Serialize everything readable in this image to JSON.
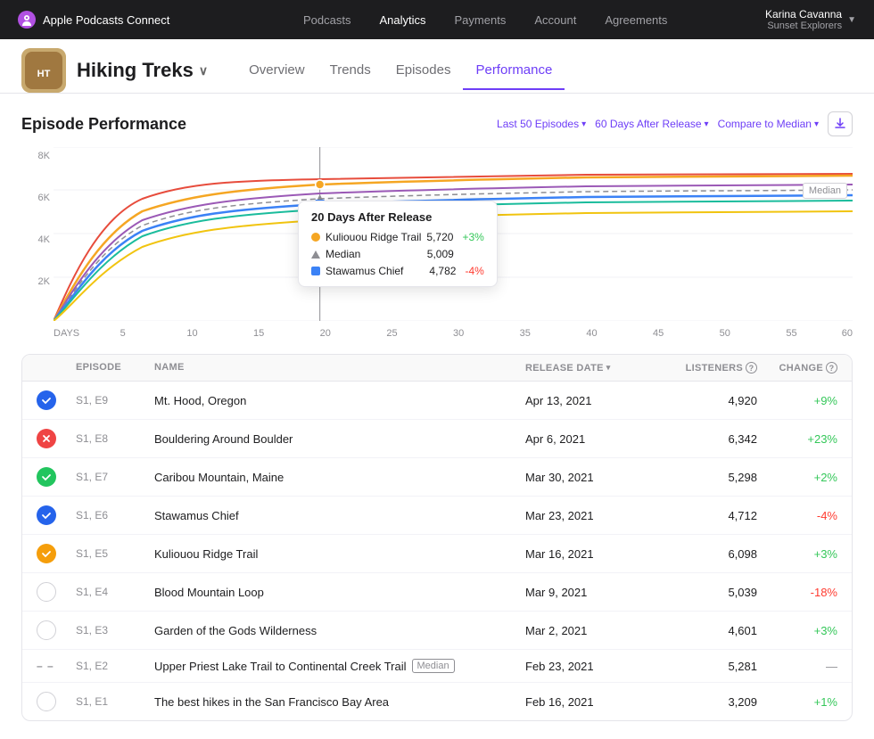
{
  "app": {
    "logo": "Apple Podcasts Connect",
    "nav": [
      {
        "label": "Podcasts",
        "active": false
      },
      {
        "label": "Analytics",
        "active": true
      },
      {
        "label": "Payments",
        "active": false
      },
      {
        "label": "Account",
        "active": false
      },
      {
        "label": "Agreements",
        "active": false
      }
    ],
    "user": {
      "name": "Karina Cavanna",
      "podcast": "Sunset Explorers"
    }
  },
  "podcast": {
    "title": "Hiking Treks",
    "tabs": [
      {
        "label": "Overview",
        "active": false
      },
      {
        "label": "Trends",
        "active": false
      },
      {
        "label": "Episodes",
        "active": false
      },
      {
        "label": "Performance",
        "active": true
      }
    ]
  },
  "performance": {
    "title": "Episode Performance",
    "filters": {
      "episodes_btn": "Last 50 Episodes",
      "days_btn": "60 Days After Release",
      "compare_btn": "Compare to Median"
    },
    "chart": {
      "y_labels": [
        "8K",
        "6K",
        "4K",
        "2K",
        ""
      ],
      "x_labels": [
        "DAYS",
        "5",
        "10",
        "15",
        "20",
        "25",
        "30",
        "35",
        "40",
        "45",
        "50",
        "55",
        "60"
      ],
      "tooltip": {
        "title": "20 Days After Release",
        "rows": [
          {
            "color": "#f5a623",
            "type": "circle",
            "name": "Kuliouou Ridge Trail",
            "value": "5,720",
            "change": "+3%",
            "change_type": "pos"
          },
          {
            "color": "#8e8e93",
            "type": "triangle",
            "name": "Median",
            "value": "5,009",
            "change": "",
            "change_type": ""
          },
          {
            "color": "#3b82f6",
            "type": "square",
            "name": "Stawamus Chief",
            "value": "4,782",
            "change": "-4%",
            "change_type": "neg"
          }
        ]
      },
      "median_label": "Median"
    },
    "table": {
      "columns": [
        "",
        "EPISODE",
        "NAME",
        "RELEASE DATE",
        "LISTENERS",
        "CHANGE"
      ],
      "rows": [
        {
          "badge_type": "blue-check",
          "episode": "S1, E9",
          "name": "Mt. Hood, Oregon",
          "date": "Apr 13, 2021",
          "listeners": "4,920",
          "change": "+9%",
          "change_type": "pos",
          "is_median": false
        },
        {
          "badge_type": "red-x",
          "episode": "S1, E8",
          "name": "Bouldering Around Boulder",
          "date": "Apr 6, 2021",
          "listeners": "6,342",
          "change": "+23%",
          "change_type": "pos",
          "is_median": false
        },
        {
          "badge_type": "green-check",
          "episode": "S1, E7",
          "name": "Caribou Mountain, Maine",
          "date": "Mar 30, 2021",
          "listeners": "5,298",
          "change": "+2%",
          "change_type": "pos",
          "is_median": false
        },
        {
          "badge_type": "blue-check",
          "episode": "S1, E6",
          "name": "Stawamus Chief",
          "date": "Mar 23, 2021",
          "listeners": "4,712",
          "change": "-4%",
          "change_type": "neg",
          "is_median": false
        },
        {
          "badge_type": "orange-check",
          "episode": "S1, E5",
          "name": "Kuliouou Ridge Trail",
          "date": "Mar 16, 2021",
          "listeners": "6,098",
          "change": "+3%",
          "change_type": "pos",
          "is_median": false
        },
        {
          "badge_type": "outline",
          "episode": "S1, E4",
          "name": "Blood Mountain Loop",
          "date": "Mar 9, 2021",
          "listeners": "5,039",
          "change": "-18%",
          "change_type": "neg",
          "is_median": false
        },
        {
          "badge_type": "outline",
          "episode": "S1, E3",
          "name": "Garden of the Gods Wilderness",
          "date": "Mar 2, 2021",
          "listeners": "4,601",
          "change": "+3%",
          "change_type": "pos",
          "is_median": false
        },
        {
          "badge_type": "dashes",
          "episode": "S1, E2",
          "name": "Upper Priest Lake Trail to Continental Creek Trail",
          "date": "Feb 23, 2021",
          "listeners": "5,281",
          "change": "—",
          "change_type": "neutral",
          "is_median": true
        },
        {
          "badge_type": "outline",
          "episode": "S1, E1",
          "name": "The best hikes in the San Francisco Bay Area",
          "date": "Feb 16, 2021",
          "listeners": "3,209",
          "change": "+1%",
          "change_type": "pos",
          "is_median": false
        }
      ]
    }
  }
}
